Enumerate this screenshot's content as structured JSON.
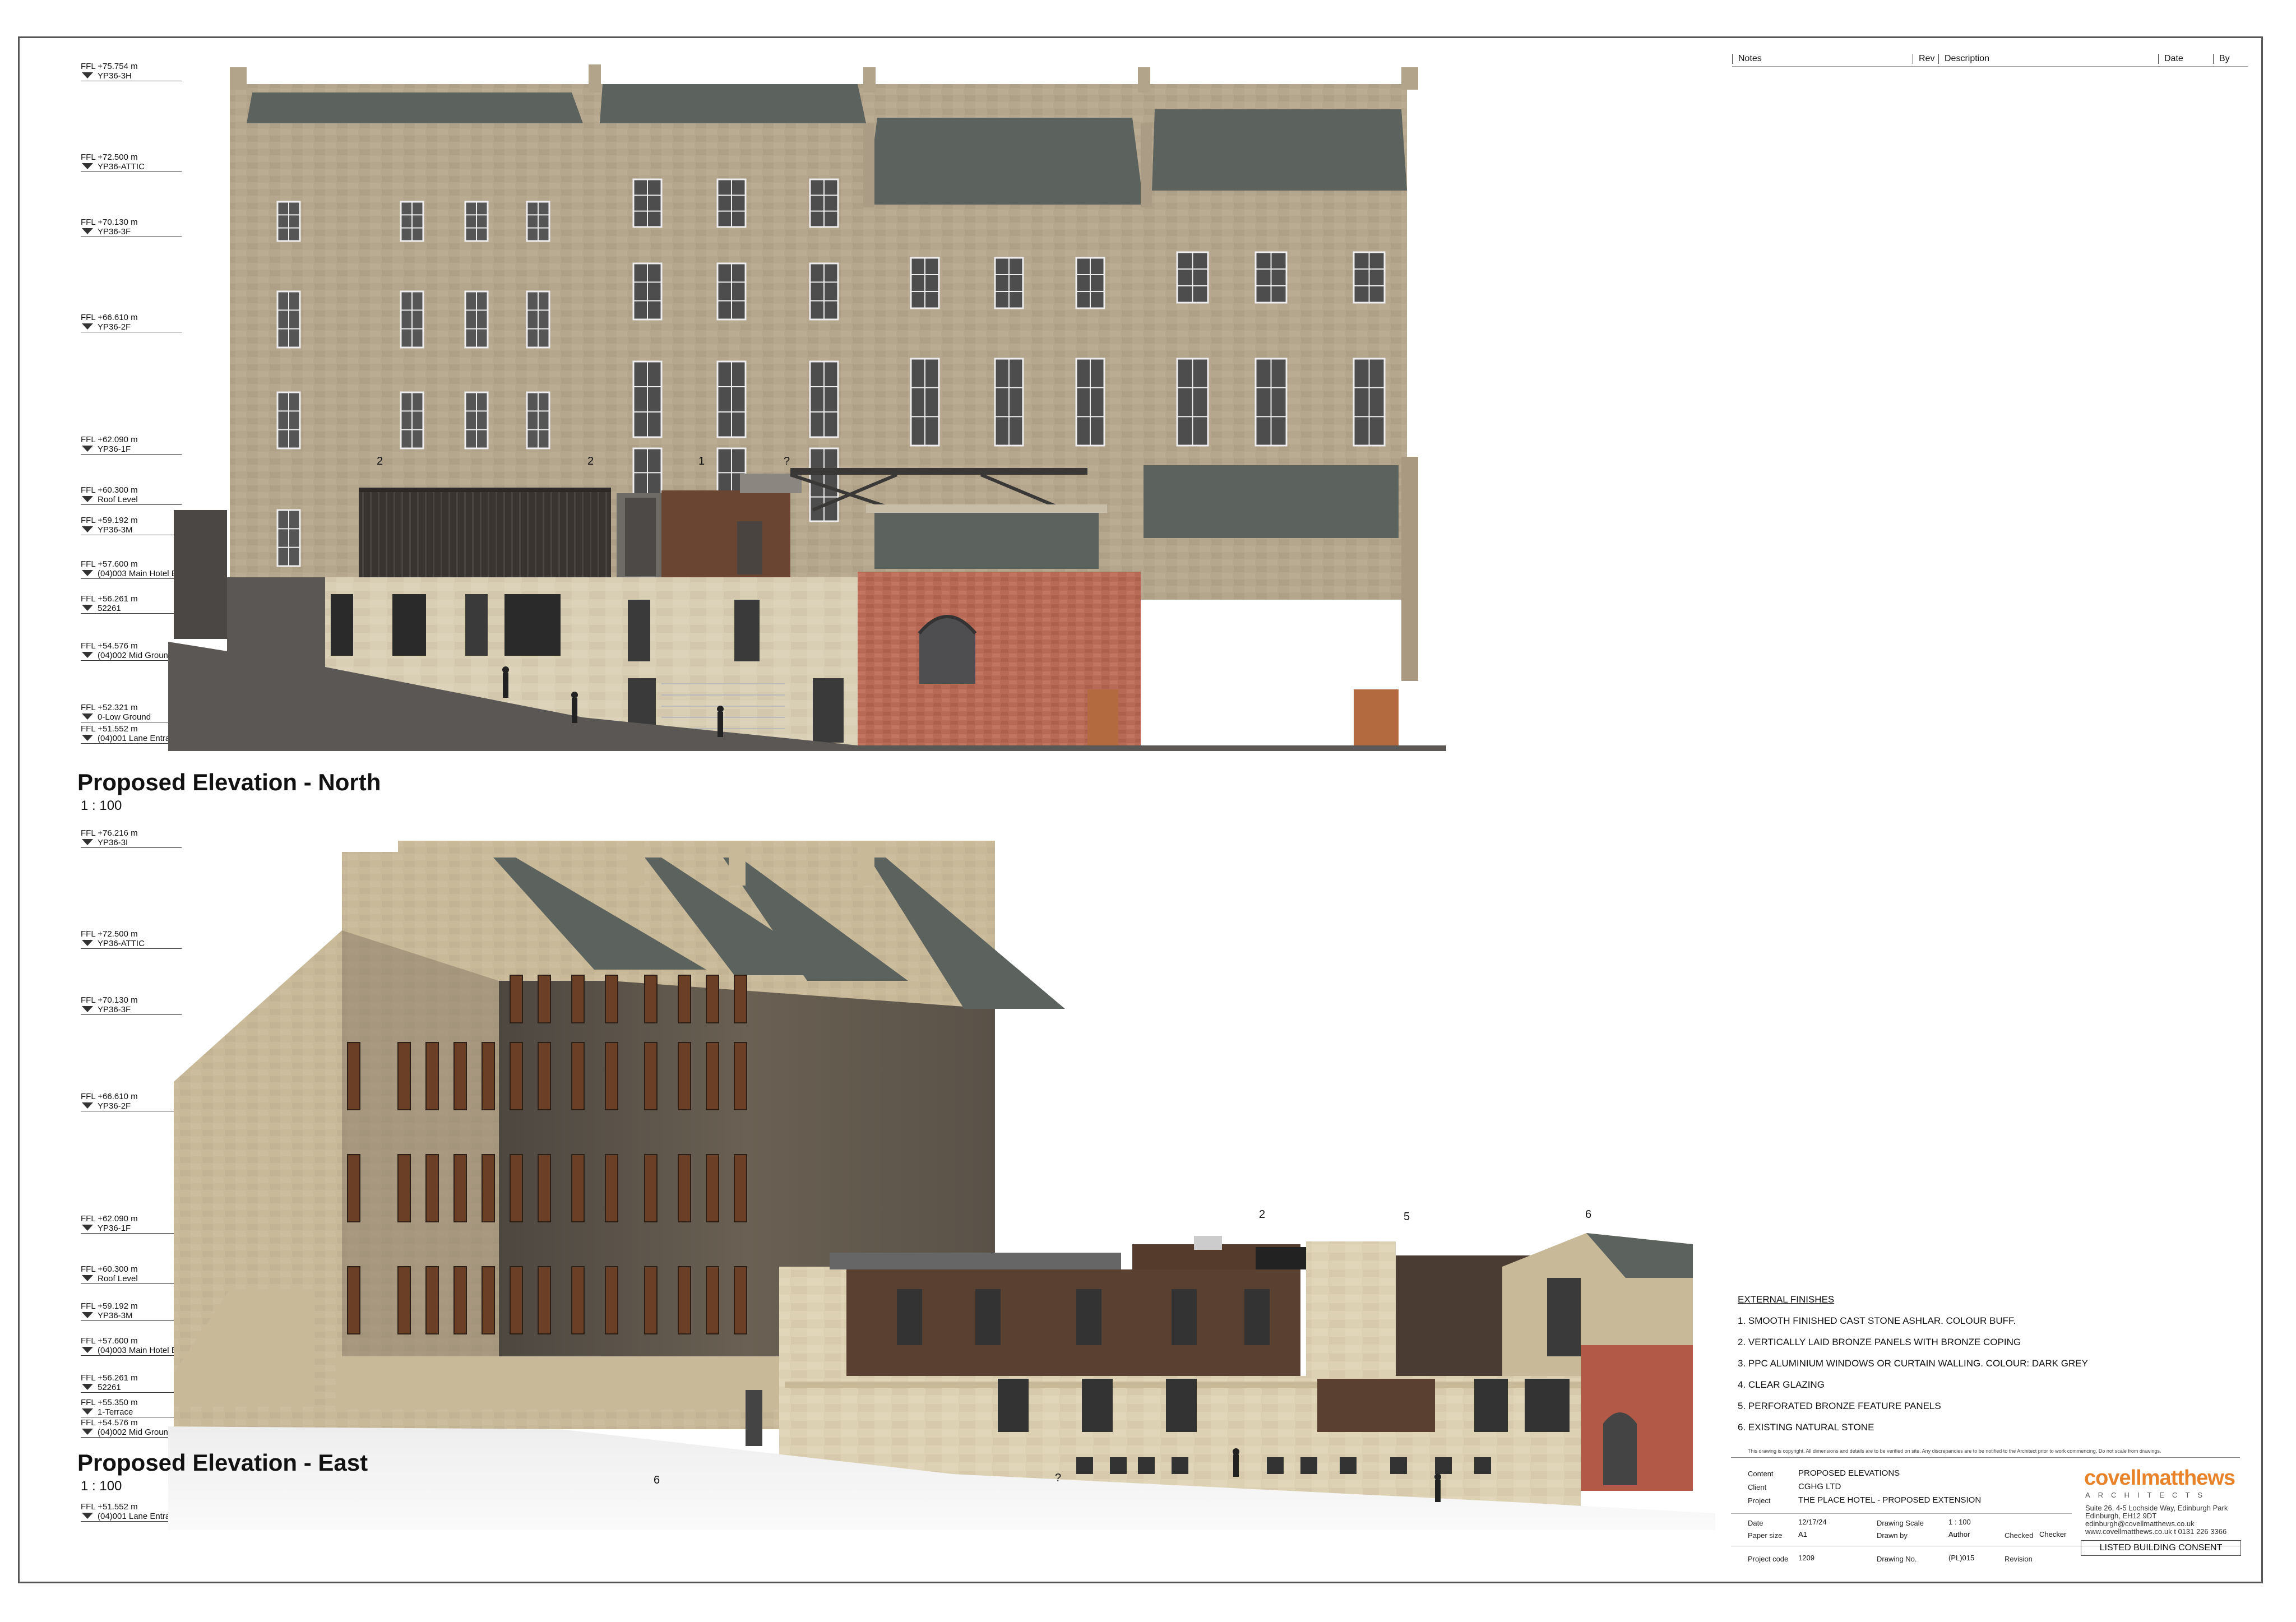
{
  "notes_header": {
    "notes": "Notes",
    "rev": "Rev",
    "description": "Description",
    "date": "Date",
    "by": "By"
  },
  "north": {
    "title": "Proposed Elevation - North",
    "scale": "1 : 100",
    "levels": [
      {
        "v": "FFL +75.754 m",
        "n": "YP36-3H"
      },
      {
        "v": "FFL +72.500 m",
        "n": "YP36-ATTIC"
      },
      {
        "v": "FFL +70.130 m",
        "n": "YP36-3F"
      },
      {
        "v": "FFL +66.610 m",
        "n": "YP36-2F"
      },
      {
        "v": "FFL +62.090 m",
        "n": "YP36-1F"
      },
      {
        "v": "FFL +60.300 m",
        "n": "Roof Level"
      },
      {
        "v": "FFL +59.192 m",
        "n": "YP36-3M"
      },
      {
        "v": "FFL +57.600 m",
        "n": "(04)003 Main Hotel Entrance"
      },
      {
        "v": "FFL +56.261 m",
        "n": "52261"
      },
      {
        "v": "FFL +54.576 m",
        "n": "(04)002 Mid Ground"
      },
      {
        "v": "FFL +52.321 m",
        "n": "0-Low Ground"
      },
      {
        "v": "FFL +51.552 m",
        "n": "(04)001 Lane Entrance"
      }
    ],
    "tags": [
      "2",
      "2",
      "1",
      "?"
    ]
  },
  "east": {
    "title": "Proposed Elevation - East",
    "scale": "1 : 100",
    "levels": [
      {
        "v": "FFL +76.216 m",
        "n": "YP36-3I"
      },
      {
        "v": "FFL +72.500 m",
        "n": "YP36-ATTIC"
      },
      {
        "v": "FFL +70.130 m",
        "n": "YP36-3F"
      },
      {
        "v": "FFL +66.610 m",
        "n": "YP36-2F"
      },
      {
        "v": "FFL +62.090 m",
        "n": "YP36-1F"
      },
      {
        "v": "FFL +60.300 m",
        "n": "Roof Level"
      },
      {
        "v": "FFL +59.192 m",
        "n": "YP36-3M"
      },
      {
        "v": "FFL +57.600 m",
        "n": "(04)003 Main Hotel Entrance"
      },
      {
        "v": "FFL +56.261 m",
        "n": "52261"
      },
      {
        "v": "FFL +55.350 m",
        "n": "1-Terrace"
      },
      {
        "v": "FFL +54.576 m",
        "n": "(04)002 Mid Ground"
      },
      {
        "v": "FFL +51.552 m",
        "n": "(04)001 Lane Entrance"
      }
    ],
    "tags": [
      "2",
      "5",
      "6",
      "6",
      "?"
    ]
  },
  "finishes": {
    "heading": "EXTERNAL FINISHES",
    "items": [
      "1. SMOOTH FINISHED CAST STONE ASHLAR. COLOUR BUFF.",
      "2. VERTICALLY LAID BRONZE PANELS WITH BRONZE COPING",
      "3. PPC ALUMINIUM WINDOWS OR CURTAIN WALLING. COLOUR: DARK GREY",
      "4. CLEAR GLAZING",
      "5. PERFORATED BRONZE FEATURE PANELS",
      "6. EXISTING NATURAL STONE"
    ]
  },
  "disclaimer": "This drawing is copyright. All dimensions and details are to be verified on site. Any discrepancies are to be notified to the Architect prior to work commencing. Do not scale from drawings.",
  "titleblock": {
    "content_label": "Content",
    "content": "PROPOSED ELEVATIONS",
    "client_label": "Client",
    "client": "CGHG LTD",
    "project_label": "Project",
    "project": "THE PLACE HOTEL - PROPOSED EXTENSION",
    "date_label": "Date",
    "date": "12/17/24",
    "scale_label": "Drawing Scale",
    "scale": "1 : 100",
    "paper_label": "Paper size",
    "paper": "A1",
    "drawn_label": "Drawn by",
    "drawn": "Author",
    "checked_label": "Checked",
    "checked": "Checker",
    "code_label": "Project code",
    "code": "1209",
    "dno_label": "Drawing No.",
    "dno": "(PL)015",
    "rev_label": "Revision",
    "logo": "covellmatthews",
    "logo_sub": "ARCHITECTS",
    "address": [
      "Suite 26, 4-5 Lochside Way, Edinburgh Park",
      "Edinburgh, EH12 9DT",
      "edinburgh@covellmatthews.co.uk",
      "www.covellmatthews.co.uk  t 0131 226 3366"
    ],
    "status": "LISTED BUILDING CONSENT"
  },
  "colors": {
    "stone": "#b3a48c",
    "slate": "#5d625c",
    "bronze": "#5a4030",
    "brick": "#b96a56",
    "cream": "#d8cdb2"
  }
}
